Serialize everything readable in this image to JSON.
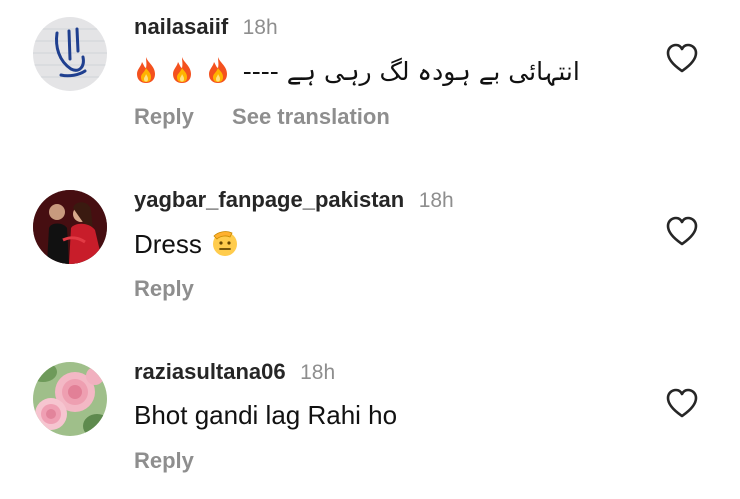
{
  "colors": {
    "username": "#262626",
    "secondary_text": "#8e8e8e",
    "body_text": "#111111",
    "background": "#ffffff"
  },
  "comments": [
    {
      "username": "nailasaiif",
      "time": "18h",
      "urdu_text": "انتہائی بے ہودہ لگ رہی ہے ----",
      "emoji_icons": [
        "fire-icon",
        "fire-icon",
        "fire-icon"
      ],
      "reply_label": "Reply",
      "see_translation_label": "See translation",
      "like_icon": "heart-outline-icon"
    },
    {
      "username": "yagbar_fanpage_pakistan",
      "time": "18h",
      "text": "Dress",
      "emoji_icons": [
        "saluting-face-icon"
      ],
      "reply_label": "Reply",
      "like_icon": "heart-outline-icon"
    },
    {
      "username": "raziasultana06",
      "time": "18h",
      "text": "Bhot gandi lag Rahi ho",
      "reply_label": "Reply",
      "like_icon": "heart-outline-icon"
    }
  ]
}
